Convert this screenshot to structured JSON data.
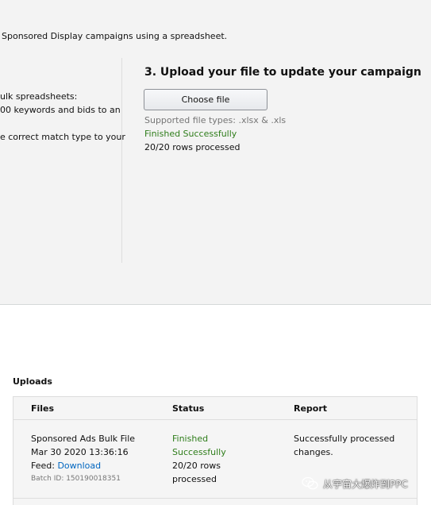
{
  "intro": {
    "text": "Sponsored Display campaigns using a spreadsheet."
  },
  "left_column": {
    "lines": [
      "ulk spreadsheets:",
      "00 keywords and bids to an",
      "",
      "e correct match type to your"
    ]
  },
  "upload_step": {
    "title": "3. Upload your file to update your campaign",
    "choose_button": "Choose file",
    "supported_types": "Supported file types: .xlsx & .xls",
    "status": "Finished Successfully",
    "rows_processed": "20/20 rows processed"
  },
  "uploads": {
    "heading": "Uploads",
    "columns": [
      "Files",
      "Status",
      "Report"
    ],
    "rows": [
      {
        "file_name": "Sponsored Ads Bulk File",
        "file_date": "Mar 30 2020 13:36:16",
        "feed_label": "Feed:",
        "feed_link": "Download",
        "batch_id": "Batch ID: 150190018351",
        "status_line1": "Finished",
        "status_line2": "Successfully",
        "rows_line1": "20/20 rows",
        "rows_line2": "processed",
        "report_line1": "Successfully processed",
        "report_line2": "changes."
      }
    ]
  },
  "watermark": {
    "text": "从宇宙大爆炸到PPC",
    "icon": "wechat-icon"
  },
  "colors": {
    "success_green": "#2e7d1a",
    "link_blue": "#0066c0",
    "panel_gray": "#f3f3f3"
  }
}
